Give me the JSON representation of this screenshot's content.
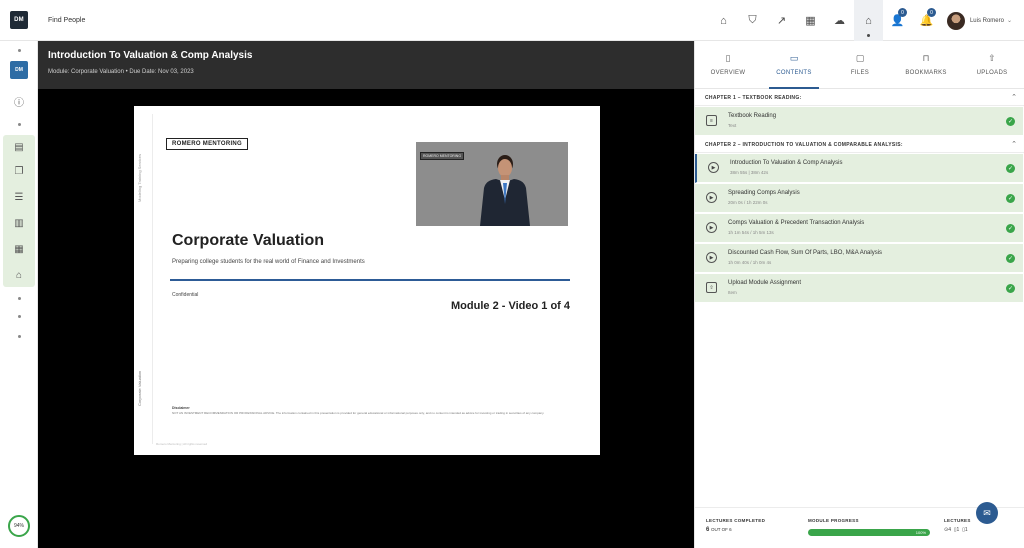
{
  "app": {
    "logo_text": "DM",
    "search_label": "Find People"
  },
  "topbar": {
    "icons": [
      "home-icon",
      "graduation-icon",
      "chart-icon",
      "grid-icon",
      "cloud-icon",
      "course-icon",
      "people-icon",
      "bell-icon"
    ],
    "people_badge": "0",
    "bell_badge": "0",
    "user_name": "Luis Romero"
  },
  "rail": {
    "logo_text": "DM",
    "progress": "94%"
  },
  "course": {
    "title": "Introduction To Valuation & Comp Analysis",
    "meta": "Module: Corporate Valuation  •  Due Date: Nov 03, 2023"
  },
  "slide": {
    "brand": "ROMERO MENTORING",
    "webcam_tag": "ROMERO MENTORING",
    "vertical_top": "Modeling Training Services",
    "vertical_bottom": "Corporate Valuation",
    "title": "Corporate Valuation",
    "subtitle": "Preparing college students for the real world of Finance and Investments",
    "confidential": "Confidential",
    "module_label": "Module 2 - Video 1 of 4",
    "disclaimer_heading": "Disclaimer",
    "disclaimer_text": "NOT AN INVESTMENT RECOMMENDATION OR PROFESSIONAL ADVICE. The information contained in this presentation is provided for general educational or informational purposes only, and no content is intended as advice for investing or trading in securities of any company.",
    "footer": "Romero Mentoring | All rights reserved"
  },
  "tabs": [
    {
      "label": "OVERVIEW",
      "icon": "overview-icon"
    },
    {
      "label": "CONTENTS",
      "icon": "contents-icon"
    },
    {
      "label": "FILES",
      "icon": "files-icon"
    },
    {
      "label": "BOOKMARKS",
      "icon": "bookmark-icon"
    },
    {
      "label": "UPLOADS",
      "icon": "upload-icon"
    }
  ],
  "active_tab": "CONTENTS",
  "chapters": [
    {
      "title": "CHAPTER 1 – TEXTBOOK READING:"
    },
    {
      "title": "CHAPTER 2 – INTRODUCTION TO VALUATION & COMPARABLE ANALYSIS:"
    }
  ],
  "lessons": [
    {
      "title": "Textbook Reading",
      "sub": "Text"
    },
    {
      "title": "Introduction To Valuation & Comp Analysis",
      "sub": "38m 55s | 38m 42s"
    },
    {
      "title": "Spreading Comps Analysis",
      "sub": "20m 0s / 1h 22m 0s"
    },
    {
      "title": "Comps Valuation & Precedent Transaction Analysis",
      "sub": "1h 1m 54s / 1h 5m 13s"
    },
    {
      "title": "Discounted Cash Flow, Sum Of Parts, LBO, M&A Analysis",
      "sub": "1h 0m 40s / 1h 0m 4s"
    },
    {
      "title": "Upload Module Assignment",
      "sub": "Item"
    }
  ],
  "stats": {
    "lectures_completed_label": "LECTURES COMPLETED",
    "lectures_completed_value": "6",
    "lectures_completed_total": "OUT OF 6",
    "module_progress_label": "MODULE PROGRESS",
    "module_progress_value": "100%",
    "lectures_label": "LECTURES",
    "count_video": "4",
    "count_doc": "1",
    "count_upload": "1"
  },
  "colors": {
    "accent": "#2c5b91",
    "complete": "#3aa54a",
    "complete_bg": "#e4efdf",
    "stage": "#000000"
  }
}
